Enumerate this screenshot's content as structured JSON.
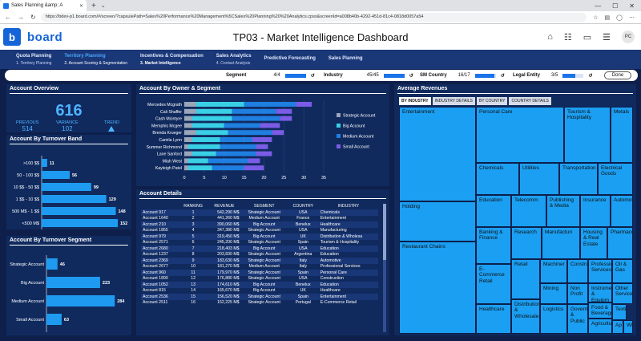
{
  "browser": {
    "tab_title": "Sales Planning &amp; A",
    "url": "https://bdev-p1.board.com/#/screen/?capsulePath=Sales%20Performance%20Management%5CSales%20Planning%20%20Analytics.cpsx&screenId=a008b40b-4292-451d-81c4-0818d0057a54"
  },
  "header": {
    "brand": "board",
    "title": "TP03 - Market Intelligence Dashboard",
    "avatar": "PC"
  },
  "menu": [
    {
      "label": "Quota Planning",
      "sub": "1. Territory Planning"
    },
    {
      "label": "Territory Planning",
      "sub": "2. Account Scoring & Segmentation",
      "active": true
    },
    {
      "label": "Incentives & Compensation",
      "sub": "3. Market Intelligence",
      "active_sub": true
    },
    {
      "label": "Sales Analytics",
      "sub": "4. Contact Analysis"
    },
    {
      "label": "Predictive Forecasting",
      "sub": ""
    },
    {
      "label": "Sales Planning",
      "sub": ""
    }
  ],
  "filters": {
    "segment": {
      "label": "Segment",
      "value": "4/4",
      "fill": 1.0
    },
    "industry": {
      "label": "Industry",
      "value": "45/45",
      "fill": 1.0
    },
    "sm_country": {
      "label": "SM Country",
      "value": "16/17",
      "fill": 0.94
    },
    "legal_entity": {
      "label": "Legal Entity",
      "value": "3/5",
      "fill": 0.6
    },
    "done": "Done"
  },
  "overview": {
    "title": "Account Overview",
    "total": "616",
    "previous_label": "PREVIOUS",
    "previous": "514",
    "variance_label": "VARIANCE",
    "variance": "102",
    "trend_label": "TREND"
  },
  "turnover_band": {
    "title": "Account By Turnover Band",
    "categories": [
      ">100 $$",
      "50 - 100 $$",
      "10 $$ - 50 $$",
      "1 $$ - 10 $$",
      "500 M$ - 1 $$",
      "<500 M$"
    ],
    "values": [
      11,
      56,
      99,
      129,
      148,
      152
    ],
    "max": 160
  },
  "turnover_segment": {
    "title": "Account By Turnover Segment",
    "categories": [
      "Strategic Account",
      "Big Account",
      "Medium Account",
      "Small Account"
    ],
    "values": [
      46,
      223,
      284,
      63
    ],
    "max": 300
  },
  "owner_segment": {
    "title": "Account By Owner & Segment",
    "owners": [
      "Mercedes Mcgrath",
      "Cali Shaffer",
      "Cash Mcintyre",
      "Memphis Mcgee",
      "Brenda Krueger",
      "Camila Lynn",
      "Summer Richmond",
      "Lane Sanford",
      "Miah West",
      "Kayleigh Patel"
    ],
    "series": [
      {
        "name": "Strategic Account",
        "color": "#9aa6b8",
        "values": [
          3,
          3,
          2,
          2,
          3,
          2,
          1,
          2,
          1,
          1
        ]
      },
      {
        "name": "Big Account",
        "color": "#39d0e6",
        "values": [
          12,
          9,
          10,
          8,
          8,
          7,
          8,
          6,
          5,
          6
        ]
      },
      {
        "name": "Medium Account",
        "color": "#1f7fe0",
        "values": [
          13,
          11,
          12,
          9,
          11,
          8,
          9,
          10,
          10,
          8
        ]
      },
      {
        "name": "Small Account",
        "color": "#7b5ce6",
        "values": [
          4,
          4,
          3,
          5,
          3,
          5,
          3,
          4,
          3,
          5
        ]
      }
    ],
    "ticks": [
      "0",
      "5",
      "10",
      "15",
      "20",
      "25",
      "30",
      "35"
    ],
    "max": 35
  },
  "details": {
    "title": "Account Details",
    "columns": [
      "",
      "RANKING",
      "REVENUE",
      "SEGMENT",
      "COUNTRY",
      "INDUSTRY"
    ],
    "rows": [
      [
        "Account 917",
        "1",
        "542,290 M$",
        "Strategic Account",
        "USA",
        "Chemicals"
      ],
      [
        "Account 1640",
        "2",
        "441,260 M$",
        "Medium Account",
        "France",
        "Entertainment"
      ],
      [
        "Account 210",
        "3",
        "390,060 M$",
        "Big Account",
        "Benelux",
        "Healthcare"
      ],
      [
        "Account 1855",
        "4",
        "347,380 M$",
        "Strategic Account",
        "USA",
        "Manufacturing"
      ],
      [
        "Account 979",
        "5",
        "319,450 M$",
        "Big Account",
        "UK",
        "Distribution & Wholesa"
      ],
      [
        "Account 2571",
        "6",
        "245,200 M$",
        "Strategic Account",
        "Spain",
        "Tourism & Hospitality"
      ],
      [
        "Account 2680",
        "7",
        "218,403 M$",
        "Big Account",
        "USA",
        "Education"
      ],
      [
        "Account 1237",
        "8",
        "203,830 M$",
        "Strategic Account",
        "Argentina",
        "Education"
      ],
      [
        "Account 2369",
        "9",
        "183,630 M$",
        "Strategic Account",
        "Italy",
        "Automotive"
      ],
      [
        "Account 2677",
        "10",
        "181,270 M$",
        "Medium Account",
        "Italy",
        "Professional Services"
      ],
      [
        "Account 960",
        "11",
        "179,970 M$",
        "Strategic Account",
        "Spain",
        "Personal Care"
      ],
      [
        "Account 1899",
        "12",
        "176,880 M$",
        "Strategic Account",
        "USA",
        "Construction"
      ],
      [
        "Account 1052",
        "13",
        "174,610 M$",
        "Big Account",
        "Benelux",
        "Education"
      ],
      [
        "Account 815",
        "14",
        "165,670 M$",
        "Big Account",
        "UK",
        "Healthcare"
      ],
      [
        "Account 2536",
        "15",
        "156,520 M$",
        "Strategic Account",
        "Spain",
        "Entertainment"
      ],
      [
        "Account 2511",
        "16",
        "152,225 M$",
        "Strategic Account",
        "Portugal",
        "E-Commerce Retail"
      ]
    ]
  },
  "avg_revenues": {
    "title": "Average Revenues",
    "tabs": [
      "BY INDUSTRY",
      "INDUSTRY DETAILS",
      "BY COUNTRY",
      "COUNTRY DETAILS"
    ],
    "cells": [
      "Entertainment",
      "Personal Care",
      "Tourism & Hospitality",
      "Metals",
      "Chemicals",
      "Utilities",
      "Transportation",
      "Electrical Goods",
      "Holding",
      "Education",
      "Telecomm",
      "Publishing & Media",
      "Insurance",
      "Automotive",
      "Banking & Finance",
      "Research",
      "Manufacturi",
      "Housing & Real Estate",
      "Pharmaceu",
      "Restaurant Chains",
      "E-Commerce Retail",
      "Retail",
      "Machiner",
      "Constru",
      "Profession Services",
      "Oil & Gas",
      "Mining",
      "Non Profit",
      "Instrume & Equipm",
      "Other Services",
      "Healthcare",
      "Distribution & Wholesale",
      "Logistics",
      "Government & Public",
      "Food & Beverage",
      "Textile",
      "Agriculture",
      "Ap",
      "Wi"
    ]
  }
}
